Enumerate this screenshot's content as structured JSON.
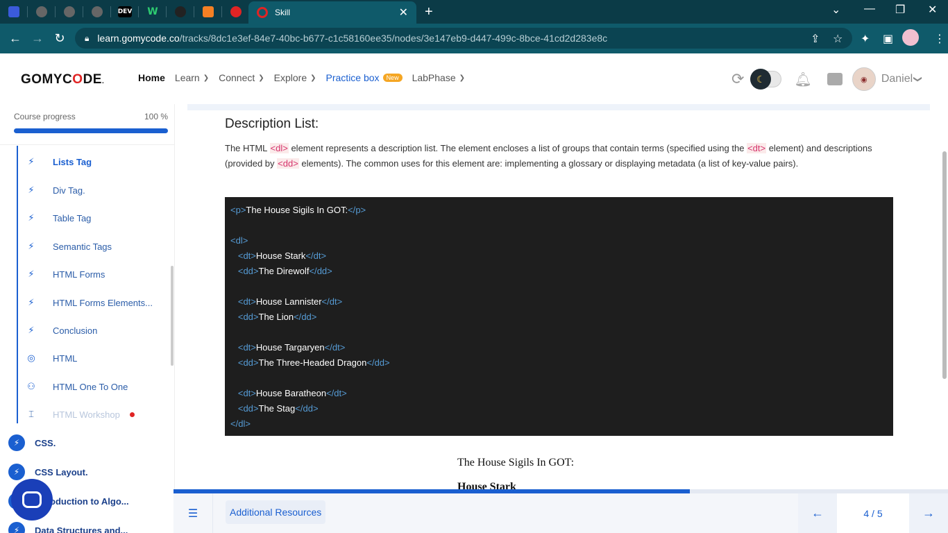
{
  "browser": {
    "active_tab_title": "Skill",
    "url_host": "learn.gomycode.co",
    "url_path": "/tracks/8dc1e3ef-84e7-40bc-b677-c1c58160ee35/nodes/3e147eb9-d447-499c-8bce-41cd2d283e8c",
    "other_tabs": [
      "tab-icon-1",
      "tab-icon-2",
      "tab-icon-3",
      "tab-icon-4",
      "DEV",
      "W",
      "tab-icon-7",
      "tab-icon-8",
      "tab-icon-9"
    ]
  },
  "header": {
    "logo_pre": "GOMYC",
    "logo_o": "O",
    "logo_post": "DE",
    "logo_mark": ".",
    "nav": {
      "home": "Home",
      "learn": "Learn",
      "connect": "Connect",
      "explore": "Explore",
      "practice": "Practice box",
      "practice_badge": "New",
      "labphase": "LabPhase"
    },
    "user_name": "Daniel"
  },
  "sidebar": {
    "progress_label": "Course progress",
    "progress_value": "100 %",
    "progress_fraction": 1.0,
    "lessons": [
      {
        "label": "Lists Tag",
        "icon": "bolt-icon"
      },
      {
        "label": "Div Tag.",
        "icon": "bolt-icon"
      },
      {
        "label": "Table Tag",
        "icon": "bolt-icon"
      },
      {
        "label": "Semantic Tags",
        "icon": "bolt-icon"
      },
      {
        "label": "HTML Forms",
        "icon": "bolt-icon"
      },
      {
        "label": "HTML Forms Elements...",
        "icon": "bolt-icon"
      },
      {
        "label": "Conclusion",
        "icon": "bolt-icon"
      },
      {
        "label": "HTML",
        "icon": "target-icon"
      },
      {
        "label": "HTML One To One",
        "icon": "people-icon"
      },
      {
        "label": "HTML Workshop",
        "icon": "workshop-icon"
      }
    ],
    "modules": [
      {
        "label": "CSS."
      },
      {
        "label": "CSS Layout."
      },
      {
        "label": "oduction to Algo..."
      },
      {
        "label": "Data Structures and..."
      }
    ]
  },
  "content": {
    "heading": "Description List:",
    "para": {
      "p1": "The HTML ",
      "tag1": "<dl>",
      "p2": " element represents a description list. The element encloses a list of groups that contain terms (specified using the ",
      "tag2": "<dt>",
      "p3": " element) and descriptions (provided by ",
      "tag3": "<dd>",
      "p4": " elements). The common uses for this element are: implementing a glossary or displaying metadata (a list of key-value pairs)."
    },
    "code_lines": [
      {
        "indent": "",
        "open": "p",
        "text": "The House Sigils In GOT:",
        "close": "p"
      },
      {
        "indent": "",
        "open": "",
        "text": "",
        "close": ""
      },
      {
        "indent": "",
        "open": "dl",
        "text": "",
        "close": ""
      },
      {
        "indent": "   ",
        "open": "dt",
        "text": "House Stark",
        "close": "dt"
      },
      {
        "indent": "   ",
        "open": "dd",
        "text": "The Direwolf",
        "close": "dd"
      },
      {
        "indent": "",
        "open": "",
        "text": "",
        "close": ""
      },
      {
        "indent": "   ",
        "open": "dt",
        "text": "House Lannister",
        "close": "dt"
      },
      {
        "indent": "   ",
        "open": "dd",
        "text": "The Lion",
        "close": "dd"
      },
      {
        "indent": "",
        "open": "",
        "text": "",
        "close": ""
      },
      {
        "indent": "   ",
        "open": "dt",
        "text": "House Targaryen",
        "close": "dt"
      },
      {
        "indent": "   ",
        "open": "dd",
        "text": "The Three-Headed Dragon",
        "close": "dd"
      },
      {
        "indent": "",
        "open": "",
        "text": "",
        "close": ""
      },
      {
        "indent": "   ",
        "open": "dt",
        "text": "House Baratheon",
        "close": "dt"
      },
      {
        "indent": "   ",
        "open": "dd",
        "text": "The Stag",
        "close": "dd"
      },
      {
        "indent": "",
        "open": "",
        "text": "",
        "close": "dl"
      }
    ],
    "rendered_title": "The House Sigils In GOT:",
    "rendered_first_term": "House Stark"
  },
  "footer": {
    "additional_resources": "Additional Resources",
    "page_indicator": "4 / 5",
    "progress_fraction": 0.667
  }
}
